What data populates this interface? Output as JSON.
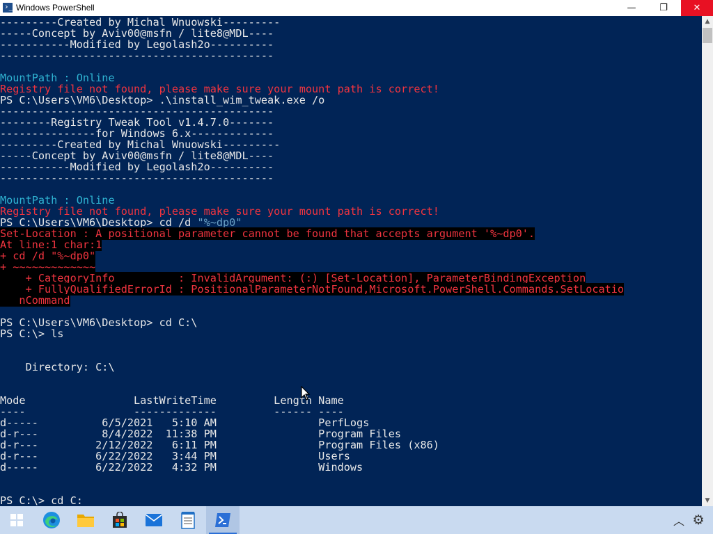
{
  "window": {
    "title": "Windows PowerShell",
    "minimize_glyph": "—",
    "maximize_glyph": "❐",
    "close_glyph": "✕"
  },
  "console": {
    "lines": [
      {
        "segments": [
          {
            "t": "---------Created by Michal Wnuowski---------",
            "c": "c-white"
          }
        ]
      },
      {
        "segments": [
          {
            "t": "-----Concept by Aviv00@msfn / lite8@MDL----",
            "c": "c-white"
          }
        ]
      },
      {
        "segments": [
          {
            "t": "-----------Modified by Legolash2o----------",
            "c": "c-white"
          }
        ]
      },
      {
        "segments": [
          {
            "t": "-------------------------------------------",
            "c": "c-white"
          }
        ]
      },
      {
        "segments": [
          {
            "t": "",
            "c": "c-white"
          }
        ]
      },
      {
        "segments": [
          {
            "t": "MountPath : Online",
            "c": "c-cyan"
          }
        ]
      },
      {
        "segments": [
          {
            "t": "Registry file not found, please make sure your mount path is correct!",
            "c": "c-red"
          }
        ]
      },
      {
        "segments": [
          {
            "t": "PS C:\\Users\\VM6\\Desktop> .\\install_wim_tweak.exe /o",
            "c": "c-white"
          }
        ]
      },
      {
        "segments": [
          {
            "t": "-------------------------------------------",
            "c": "c-white"
          }
        ]
      },
      {
        "segments": [
          {
            "t": "--------Registry Tweak Tool v1.4.7.0-------",
            "c": "c-white"
          }
        ]
      },
      {
        "segments": [
          {
            "t": "---------------for Windows 6.x-------------",
            "c": "c-white"
          }
        ]
      },
      {
        "segments": [
          {
            "t": "---------Created by Michal Wnuowski---------",
            "c": "c-white"
          }
        ]
      },
      {
        "segments": [
          {
            "t": "-----Concept by Aviv00@msfn / lite8@MDL----",
            "c": "c-white"
          }
        ]
      },
      {
        "segments": [
          {
            "t": "-----------Modified by Legolash2o----------",
            "c": "c-white"
          }
        ]
      },
      {
        "segments": [
          {
            "t": "-------------------------------------------",
            "c": "c-white"
          }
        ]
      },
      {
        "segments": [
          {
            "t": "",
            "c": "c-white"
          }
        ]
      },
      {
        "segments": [
          {
            "t": "MountPath : Online",
            "c": "c-cyan"
          }
        ]
      },
      {
        "segments": [
          {
            "t": "Registry file not found, please make sure your mount path is correct!",
            "c": "c-red"
          }
        ]
      },
      {
        "segments": [
          {
            "t": "PS C:\\Users\\VM6\\Desktop> cd /d ",
            "c": "c-white"
          },
          {
            "t": "\"%~dp0\"",
            "c": "c-string"
          }
        ]
      },
      {
        "segments": [
          {
            "t": "Set-Location : A positional parameter cannot be found that accepts argument '%~dp0'.",
            "c": "c-errbg"
          }
        ]
      },
      {
        "segments": [
          {
            "t": "At line:1 char:1",
            "c": "c-errbg"
          }
        ]
      },
      {
        "segments": [
          {
            "t": "+ cd /d \"%~dp0\"",
            "c": "c-errbg"
          }
        ]
      },
      {
        "segments": [
          {
            "t": "+ ~~~~~~~~~~~~~",
            "c": "c-errbg"
          }
        ]
      },
      {
        "segments": [
          {
            "t": "    + CategoryInfo          : InvalidArgument: (:) [Set-Location], ParameterBindingException",
            "c": "c-errbg"
          }
        ]
      },
      {
        "segments": [
          {
            "t": "    + FullyQualifiedErrorId : PositionalParameterNotFound,Microsoft.PowerShell.Commands.SetLocatio",
            "c": "c-errbg"
          }
        ]
      },
      {
        "segments": [
          {
            "t": "   nCommand",
            "c": "c-errbg"
          }
        ]
      },
      {
        "segments": [
          {
            "t": "",
            "c": "c-white"
          }
        ]
      },
      {
        "segments": [
          {
            "t": "PS C:\\Users\\VM6\\Desktop> cd C:\\",
            "c": "c-white"
          }
        ]
      },
      {
        "segments": [
          {
            "t": "PS C:\\> ls",
            "c": "c-white"
          }
        ]
      },
      {
        "segments": [
          {
            "t": "",
            "c": "c-white"
          }
        ]
      },
      {
        "segments": [
          {
            "t": "",
            "c": "c-white"
          }
        ]
      },
      {
        "segments": [
          {
            "t": "    Directory: C:\\",
            "c": "c-white"
          }
        ]
      },
      {
        "segments": [
          {
            "t": "",
            "c": "c-white"
          }
        ]
      },
      {
        "segments": [
          {
            "t": "",
            "c": "c-white"
          }
        ]
      },
      {
        "segments": [
          {
            "t": "Mode                 LastWriteTime         Length Name",
            "c": "c-white"
          }
        ]
      },
      {
        "segments": [
          {
            "t": "----                 -------------         ------ ----",
            "c": "c-white"
          }
        ]
      },
      {
        "segments": [
          {
            "t": "d-----          6/5/2021   5:10 AM                PerfLogs",
            "c": "c-white"
          }
        ]
      },
      {
        "segments": [
          {
            "t": "d-r---          8/4/2022  11:38 PM                Program Files",
            "c": "c-white"
          }
        ]
      },
      {
        "segments": [
          {
            "t": "d-r---         2/12/2022   6:11 PM                Program Files (x86)",
            "c": "c-white"
          }
        ]
      },
      {
        "segments": [
          {
            "t": "d-r---         6/22/2022   3:44 PM                Users",
            "c": "c-white"
          }
        ]
      },
      {
        "segments": [
          {
            "t": "d-----         6/22/2022   4:32 PM                Windows",
            "c": "c-white"
          }
        ]
      },
      {
        "segments": [
          {
            "t": "",
            "c": "c-white"
          }
        ]
      },
      {
        "segments": [
          {
            "t": "",
            "c": "c-white"
          }
        ]
      },
      {
        "segments": [
          {
            "t": "PS C:\\> cd C:",
            "c": "c-white"
          }
        ]
      }
    ]
  },
  "scrollbar": {
    "up_glyph": "▲",
    "down_glyph": "▼"
  },
  "taskbar": {
    "items": [
      {
        "name": "start-button",
        "icon": "windows-logo-icon"
      },
      {
        "name": "edge-taskbar-button",
        "icon": "edge-icon"
      },
      {
        "name": "file-explorer-taskbar-button",
        "icon": "folder-icon"
      },
      {
        "name": "store-taskbar-button",
        "icon": "store-bag-icon"
      },
      {
        "name": "mail-taskbar-button",
        "icon": "mail-icon"
      },
      {
        "name": "notepad-taskbar-button",
        "icon": "notepad-icon"
      },
      {
        "name": "powershell-taskbar-button",
        "icon": "powershell-icon",
        "active": true
      }
    ],
    "tray": {
      "chevron_glyph": "︿",
      "gear_glyph": "⚙"
    }
  },
  "colors": {
    "console_bg": "#012456",
    "error_red": "#f0343f",
    "cyan": "#2fb4d3",
    "close_red": "#e81123",
    "taskbar": "#c9daf0"
  }
}
